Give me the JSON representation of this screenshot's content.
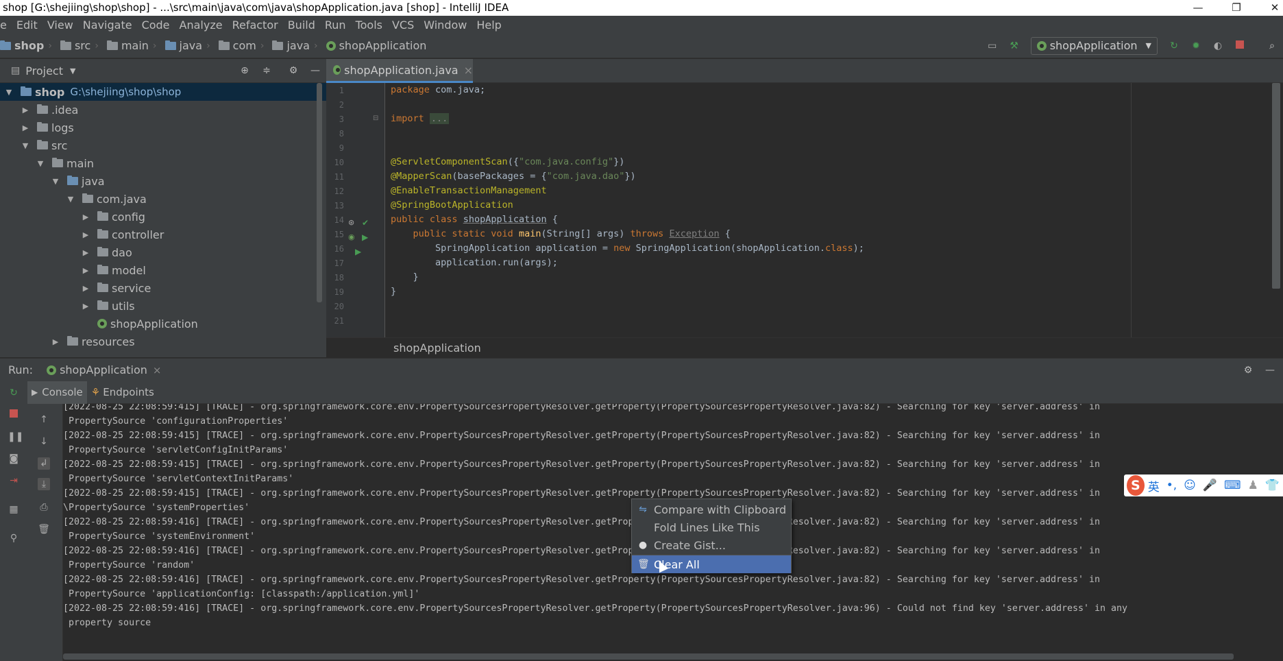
{
  "title": "shop [G:\\shejiing\\shop\\shop] - ...\\src\\main\\java\\com\\java\\shopApplication.java [shop] - IntelliJ IDEA",
  "window_controls": {
    "minimize": "—",
    "restore": "❐",
    "close": "✕"
  },
  "menu": [
    "e",
    "Edit",
    "View",
    "Navigate",
    "Code",
    "Analyze",
    "Refactor",
    "Build",
    "Run",
    "Tools",
    "VCS",
    "Window",
    "Help"
  ],
  "breadcrumbs": [
    "shop",
    "src",
    "main",
    "java",
    "com",
    "java",
    "shopApplication"
  ],
  "run_config": {
    "label": "shopApplication",
    "arrow": "▼"
  },
  "project": {
    "header": "Project",
    "tree": [
      {
        "label": "shop",
        "path": "G:\\shejiing\\shop\\shop",
        "arrow": "▼"
      },
      {
        "label": ".idea",
        "arrow": "▶"
      },
      {
        "label": "logs",
        "arrow": "▶"
      },
      {
        "label": "src",
        "arrow": "▼"
      },
      {
        "label": "main",
        "arrow": "▼"
      },
      {
        "label": "java",
        "arrow": "▼"
      },
      {
        "label": "com.java",
        "arrow": "▼"
      },
      {
        "label": "config",
        "arrow": "▶"
      },
      {
        "label": "controller",
        "arrow": "▶"
      },
      {
        "label": "dao",
        "arrow": "▶"
      },
      {
        "label": "model",
        "arrow": "▶"
      },
      {
        "label": "service",
        "arrow": "▶"
      },
      {
        "label": "utils",
        "arrow": "▶"
      },
      {
        "label": "shopApplication",
        "arrow": ""
      },
      {
        "label": "resources",
        "arrow": "▶"
      }
    ]
  },
  "editor": {
    "tab": "shopApplication.java",
    "tab_close": "×",
    "line_numbers": [
      "1",
      "2",
      "3",
      "8",
      "9",
      "10",
      "11",
      "12",
      "13",
      "14",
      "15",
      "16",
      "17",
      "18",
      "19",
      "20",
      "21"
    ],
    "code": {
      "l1_kw": "package",
      "l1_rest": " com.java;",
      "l3_kw": "import",
      "l3_fold": "...",
      "l11_ann": "@ServletComponentScan",
      "l11_a": "({",
      "l11_str": "\"com.java.config\"",
      "l11_b": "})",
      "l12_ann": "@MapperScan",
      "l12_a": "(basePackages = {",
      "l12_str": "\"com.java.dao\"",
      "l12_b": "})",
      "l13_ann": "@EnableTransactionManagement",
      "l14_ann": "@SpringBootApplication",
      "l15_kw": "public class",
      "l15_name": "shopApplication",
      "l15_rest": " {",
      "l16_kw1": "public static void",
      "l16_mth": "main",
      "l16_a": "(String[] args) ",
      "l16_kw2": "throws",
      "l16_exc": "Exception",
      "l16_b": " {",
      "l17_a": "SpringApplication application = ",
      "l17_kw": "new",
      "l17_b": " SpringApplication(shopApplication.",
      "l17_kw2": "class",
      "l17_c": ");",
      "l18": "application.run(args);",
      "l19": "}",
      "l20": "}"
    },
    "status": "shopApplication"
  },
  "run": {
    "label": "Run:",
    "tab": "shopApplication",
    "tab_close": "×",
    "subtabs": [
      "Console",
      "Endpoints"
    ],
    "console": [
      "[2022-08-25 22:08:59:415] [TRACE] - org.springframework.core.env.PropertySourcesPropertyResolver.getProperty(PropertySourcesPropertyResolver.java:82) - Searching for key 'server.address' in",
      " PropertySource 'configurationProperties'",
      "[2022-08-25 22:08:59:415] [TRACE] - org.springframework.core.env.PropertySourcesPropertyResolver.getProperty(PropertySourcesPropertyResolver.java:82) - Searching for key 'server.address' in",
      " PropertySource 'servletConfigInitParams'",
      "[2022-08-25 22:08:59:415] [TRACE] - org.springframework.core.env.PropertySourcesPropertyResolver.getProperty(PropertySourcesPropertyResolver.java:82) - Searching for key 'server.address' in",
      " PropertySource 'servletContextInitParams'",
      "[2022-08-25 22:08:59:415] [TRACE] - org.springframework.core.env.PropertySourcesPropertyResolver.getProperty(PropertySourcesPropertyResolver.java:82) - Searching for key 'server.address' in",
      "\\PropertySource 'systemProperties'",
      "[2022-08-25 22:08:59:416] [TRACE] - org.springframework.core.env.PropertySourcesPropertyResolver.getProperty(PropertySourcesPropertyResolver.java:82) - Searching for key 'server.address' in",
      " PropertySource 'systemEnvironment'",
      "[2022-08-25 22:08:59:416] [TRACE] - org.springframework.core.env.PropertySourcesPropertyResolver.getProperty(PropertySourcesPropertyResolver.java:82) - Searching for key 'server.address' in",
      " PropertySource 'random'",
      "[2022-08-25 22:08:59:416] [TRACE] - org.springframework.core.env.PropertySourcesPropertyResolver.getProperty(PropertySourcesPropertyResolver.java:82) - Searching for key 'server.address' in",
      " PropertySource 'applicationConfig: [classpath:/application.yml]'",
      "[2022-08-25 22:08:59:416] [TRACE] - org.springframework.core.env.PropertySourcesPropertyResolver.getProperty(PropertySourcesPropertyResolver.java:96) - Could not find key 'server.address' in any",
      " property source"
    ]
  },
  "context_menu": [
    "Compare with Clipboard",
    "Fold Lines Like This",
    "Create Gist...",
    "Clear All"
  ],
  "ime": {
    "logo": "S",
    "mode": "英"
  },
  "colors": {
    "accent": "#4a88c7",
    "menu_highlight": "#4b6eaf",
    "stop_red": "#c75450",
    "run_green": "#499c54"
  }
}
